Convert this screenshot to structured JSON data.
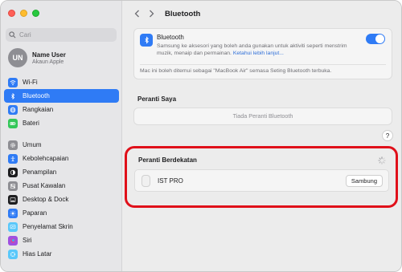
{
  "sidebar": {
    "search_placeholder": "Cari",
    "user": {
      "initials": "UN",
      "name": "Name User",
      "subtitle": "Akaun Apple"
    },
    "group1": [
      {
        "label": "Wi-Fi",
        "icon": "wifi-icon",
        "color": "#2f7bf5"
      },
      {
        "label": "Bluetooth",
        "icon": "bluetooth-icon",
        "color": "#2f7bf5",
        "active": true
      },
      {
        "label": "Rangkaian",
        "icon": "globe-icon",
        "color": "#2f7bf5"
      },
      {
        "label": "Bateri",
        "icon": "battery-icon",
        "color": "#34c759"
      }
    ],
    "group2": [
      {
        "label": "Umum",
        "icon": "gear-icon",
        "color": "#8e8e93"
      },
      {
        "label": "Kebolehcapaian",
        "icon": "accessibility-icon",
        "color": "#2f7bf5"
      },
      {
        "label": "Penampilan",
        "icon": "appearance-icon",
        "color": "#1d1d1f"
      },
      {
        "label": "Pusat Kawalan",
        "icon": "control-center-icon",
        "color": "#8e8e93"
      },
      {
        "label": "Desktop & Dock",
        "icon": "dock-icon",
        "color": "#1d1d1f"
      },
      {
        "label": "Paparan",
        "icon": "display-icon",
        "color": "#2f7bf5"
      },
      {
        "label": "Penyelamat Skrin",
        "icon": "screensaver-icon",
        "color": "#5ac8fa"
      },
      {
        "label": "Siri",
        "icon": "siri-icon",
        "color": "#a050e0"
      },
      {
        "label": "Hias Latar",
        "icon": "wallpaper-icon",
        "color": "#5ac8fa"
      }
    ]
  },
  "header": {
    "title": "Bluetooth"
  },
  "bluetooth": {
    "title": "Bluetooth",
    "description": "Samsung ke aksesori yang boleh anda gunakan untuk aktiviti seperti menstrim muzik, menaip dan permainan.",
    "link": "Ketahui lebih lanjut...",
    "enabled": true,
    "note": "Mac ini boleh ditemui sebagai \"MacBook Air\" semasa Seting Bluetooth terbuka."
  },
  "my_devices": {
    "label": "Peranti Saya",
    "empty": "Tiada Peranti Bluetooth"
  },
  "nearby": {
    "label": "Peranti Berdekatan",
    "devices": [
      {
        "name": "IST PRO",
        "action": "Sambung"
      }
    ]
  },
  "help_label": "?",
  "colors": {
    "accent": "#2f7bf5",
    "highlight": "#e0101a"
  }
}
